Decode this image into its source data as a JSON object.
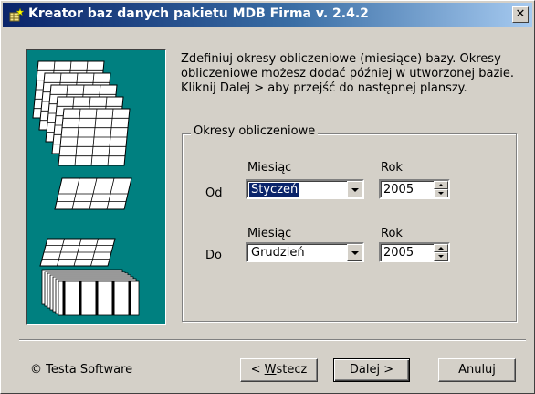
{
  "window": {
    "title": "Kreator baz danych pakietu MDB Firma v. 2.4.2",
    "close_glyph": "✕",
    "titlebar_color": "#0a246a",
    "face_color": "#d4d0c8"
  },
  "illustration": {
    "background": "#008080",
    "icon": "spreadsheet-stack-icon"
  },
  "intro": {
    "line1": "Zdefiniuj okresy obliczeniowe (miesiące) bazy. Okresy",
    "line2": "obliczeniowe możesz dodać później w utworzonej bazie.",
    "line3": "Kliknij Dalej > aby przejść do następnej planszy."
  },
  "periods": {
    "group_label": "Okresy obliczeniowe",
    "from": {
      "label": "Od",
      "month_header": "Miesiąc",
      "year_header": "Rok",
      "month": "Styczeń",
      "year": "2005"
    },
    "to": {
      "label": "Do",
      "month_header": "Miesiąc",
      "year_header": "Rok",
      "month": "Grudzień",
      "year": "2005"
    }
  },
  "footer": {
    "copyright": "© Testa Software",
    "back_prefix": "< ",
    "back_mnemonic": "W",
    "back_rest": "stecz",
    "next_label": "Dalej >",
    "cancel_label": "Anuluj"
  }
}
